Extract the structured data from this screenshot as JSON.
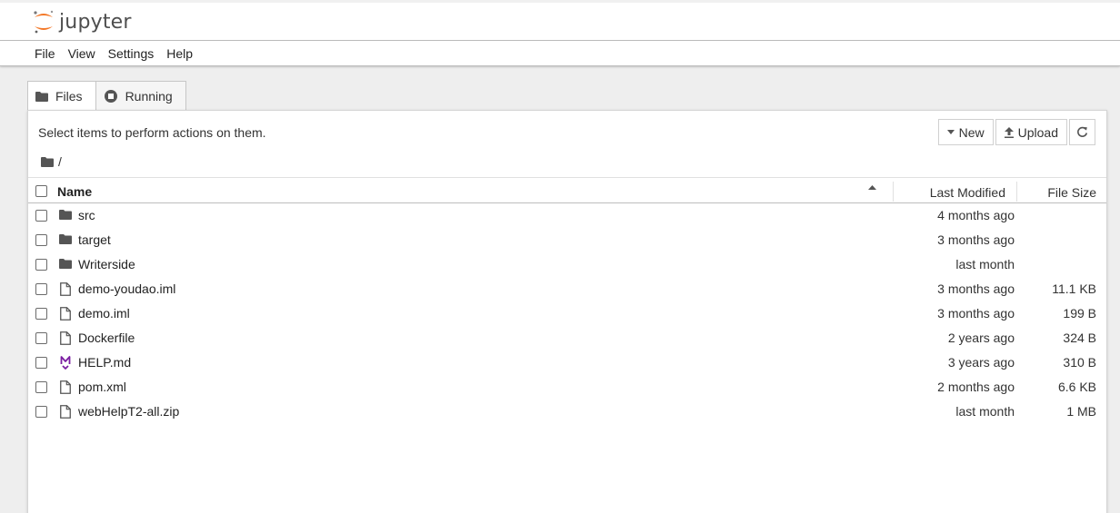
{
  "app": {
    "logo_text": "jupyter",
    "accent_color": "#F37726"
  },
  "menubar": {
    "items": [
      {
        "label": "File"
      },
      {
        "label": "View"
      },
      {
        "label": "Settings"
      },
      {
        "label": "Help"
      }
    ]
  },
  "tabs": [
    {
      "label": "Files",
      "icon": "folder-icon",
      "active": true
    },
    {
      "label": "Running",
      "icon": "stop-circle-icon",
      "active": false
    }
  ],
  "browser": {
    "hint": "Select items to perform actions on them.",
    "toolbar": {
      "new_label": "New",
      "upload_label": "Upload",
      "refresh_icon": "refresh-icon"
    },
    "breadcrumb": {
      "home_icon": "folder-icon",
      "path": "/"
    },
    "columns": {
      "name": "Name",
      "modified": "Last Modified",
      "size": "File Size"
    },
    "files": [
      {
        "name": "src",
        "type": "folder",
        "modified": "4 months ago",
        "size": ""
      },
      {
        "name": "target",
        "type": "folder",
        "modified": "3 months ago",
        "size": ""
      },
      {
        "name": "Writerside",
        "type": "folder",
        "modified": "last month",
        "size": ""
      },
      {
        "name": "demo-youdao.iml",
        "type": "file",
        "modified": "3 months ago",
        "size": "11.1 KB"
      },
      {
        "name": "demo.iml",
        "type": "file",
        "modified": "3 months ago",
        "size": "199 B"
      },
      {
        "name": "Dockerfile",
        "type": "file",
        "modified": "2 years ago",
        "size": "324 B"
      },
      {
        "name": "HELP.md",
        "type": "markdown",
        "modified": "3 years ago",
        "size": "310 B"
      },
      {
        "name": "pom.xml",
        "type": "file",
        "modified": "2 months ago",
        "size": "6.6 KB"
      },
      {
        "name": "webHelpT2-all.zip",
        "type": "file",
        "modified": "last month",
        "size": "1 MB"
      }
    ]
  }
}
